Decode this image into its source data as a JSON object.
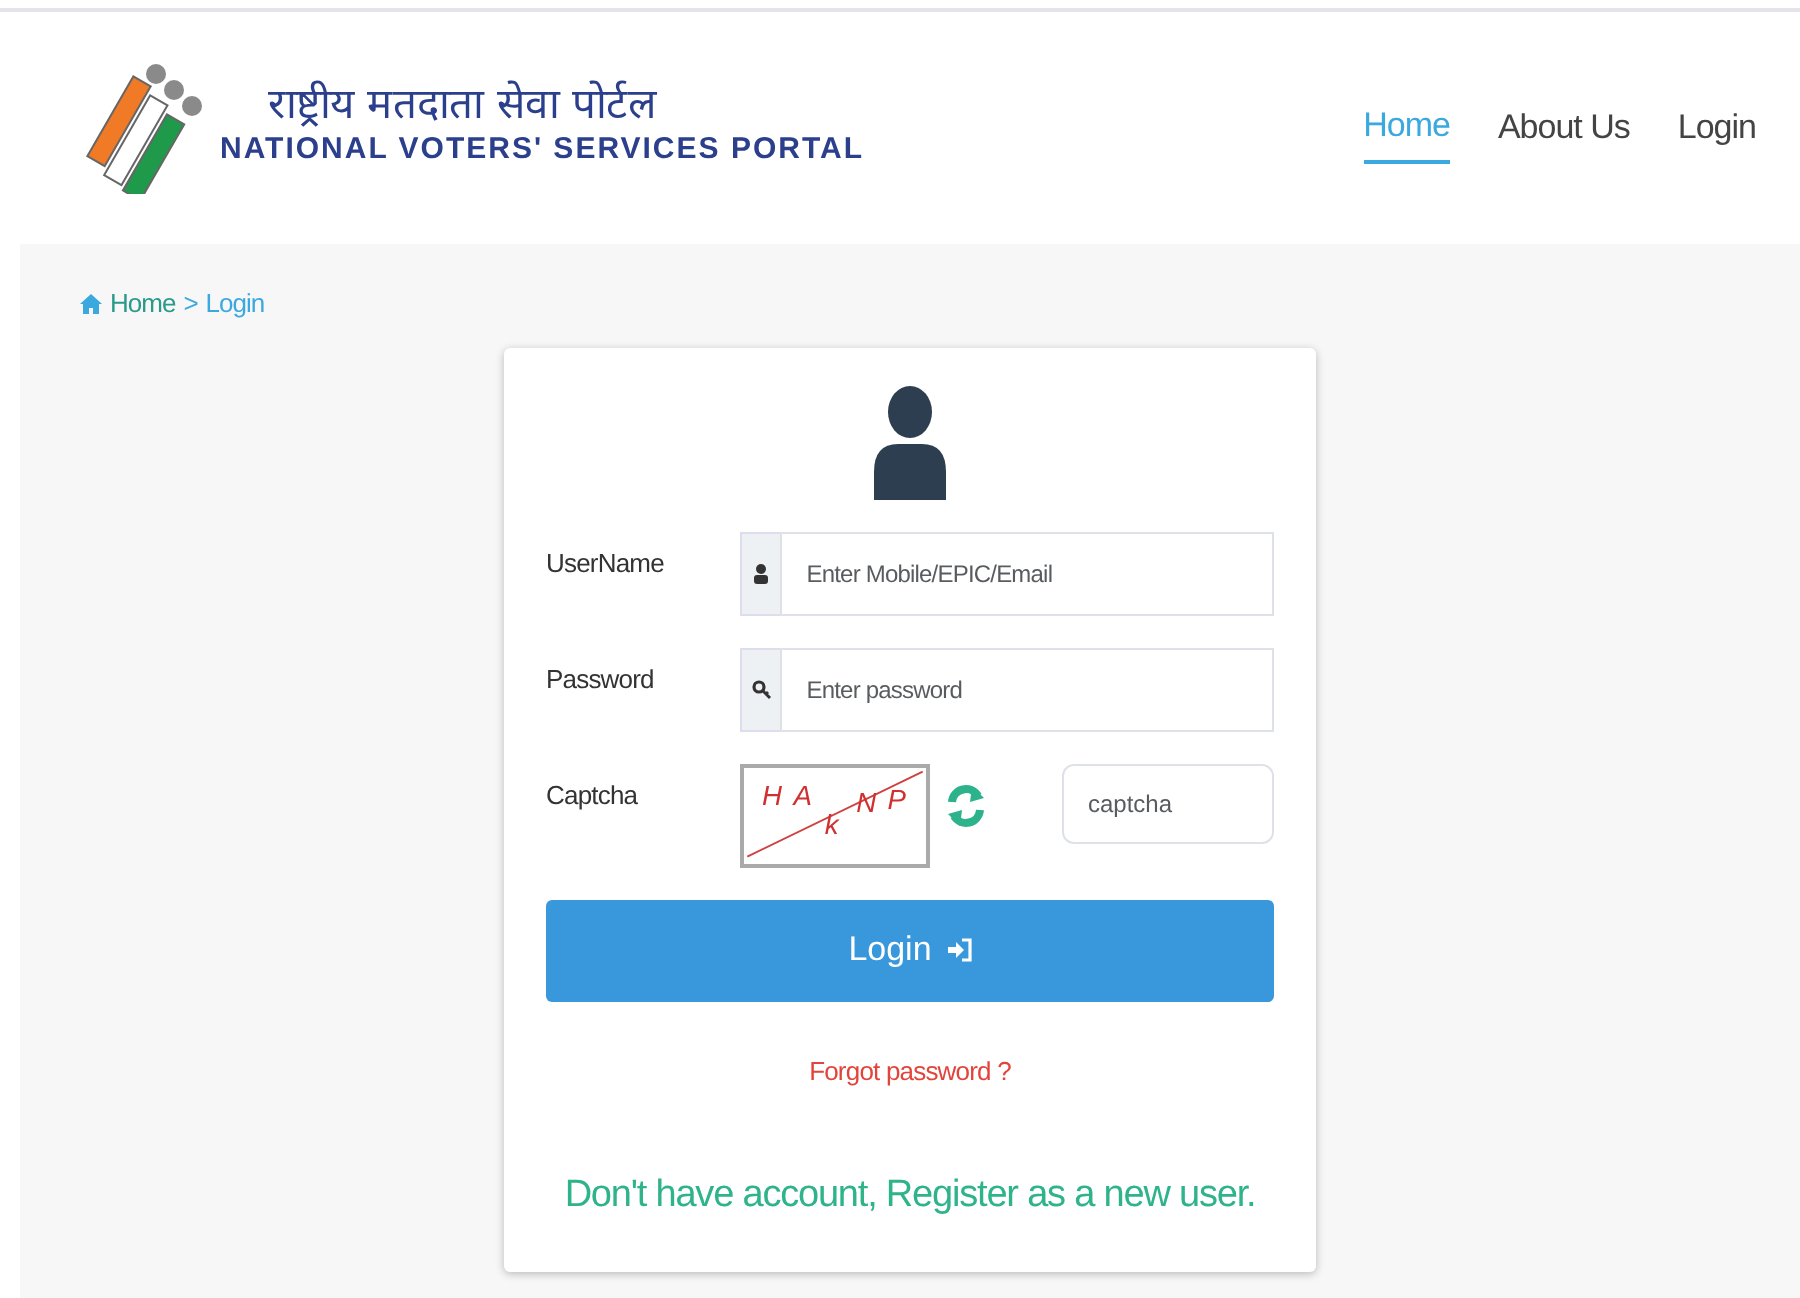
{
  "header": {
    "logo": {
      "title_hindi": "राष्ट्रीय मतदाता सेवा पोर्टल",
      "title_english": "NATIONAL VOTERS' SERVICES PORTAL"
    },
    "nav": [
      {
        "label": "Home",
        "selected": true
      },
      {
        "label": "About Us",
        "selected": false
      },
      {
        "label": "Login",
        "selected": false
      }
    ]
  },
  "breadcrumb": [
    {
      "label": "Home",
      "kind": "link"
    },
    {
      "label": ">",
      "kind": "separator"
    },
    {
      "label": "Login",
      "kind": "current"
    }
  ],
  "login_form": {
    "fields": [
      {
        "label": "UserName",
        "kind": "username",
        "placeholder": "Enter Mobile/EPIC/Email"
      },
      {
        "label": "Password",
        "kind": "password",
        "placeholder": "Enter password"
      },
      {
        "label": "Captcha",
        "kind": "captcha",
        "captcha_letters": [
          "H",
          "A",
          "k",
          "N",
          "P"
        ],
        "placeholder": "captcha"
      }
    ],
    "submit": "Login",
    "forgot": "Forgot password ?",
    "register": "Don't have account, Register as a new user."
  }
}
